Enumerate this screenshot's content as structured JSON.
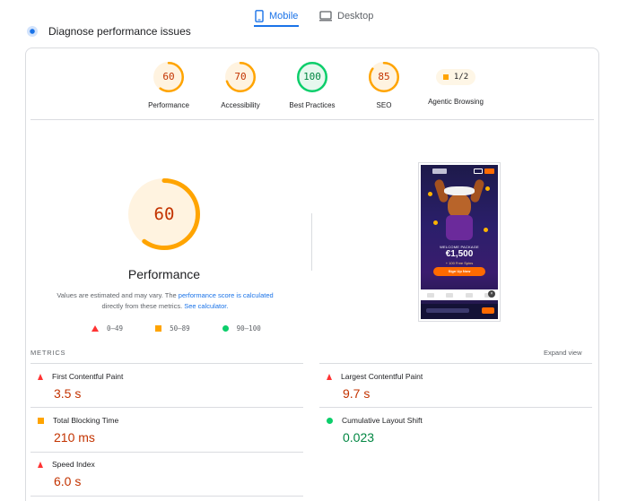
{
  "tabs": [
    {
      "label": "Mobile",
      "active": true
    },
    {
      "label": "Desktop",
      "active": false
    }
  ],
  "section_title": "Diagnose performance issues",
  "categories": [
    {
      "label": "Performance",
      "score": "60",
      "value": 60,
      "color": "#ffa400",
      "bg": "#fff3e0",
      "text_color": "#c33300"
    },
    {
      "label": "Accessibility",
      "score": "70",
      "value": 70,
      "color": "#ffa400",
      "bg": "#fff3e0",
      "text_color": "#c33300"
    },
    {
      "label": "Best Practices",
      "score": "100",
      "value": 100,
      "color": "#0cce6b",
      "bg": "#e6f8ee",
      "text_color": "#018642"
    },
    {
      "label": "SEO",
      "score": "85",
      "value": 85,
      "color": "#ffa400",
      "bg": "#fff3e0",
      "text_color": "#c33300"
    }
  ],
  "agentic": {
    "label": "Agentic Browsing",
    "badge": "1/2"
  },
  "main_gauge": {
    "score": "60",
    "value": 60,
    "label": "Performance",
    "color": "#ffa400"
  },
  "note": {
    "text1": "Values are estimated and may vary. The ",
    "link1": "performance score is calculated",
    "text2": " directly from these metrics. ",
    "link2": "See calculator."
  },
  "legend": {
    "fail": "0–49",
    "average": "50–89",
    "pass": "90–100"
  },
  "screenshot": {
    "package_label": "WELCOME PACKAGE",
    "amount": "€1,500",
    "spins": "+ 100 Free Spins",
    "cta": "Sign Up Now"
  },
  "metrics": {
    "title": "METRICS",
    "expand": "Expand view",
    "items": [
      {
        "name": "First Contentful Paint",
        "value": "3.5 s",
        "status": "fail"
      },
      {
        "name": "Largest Contentful Paint",
        "value": "9.7 s",
        "status": "fail"
      },
      {
        "name": "Total Blocking Time",
        "value": "210 ms",
        "status": "average"
      },
      {
        "name": "Cumulative Layout Shift",
        "value": "0.023",
        "status": "pass"
      },
      {
        "name": "Speed Index",
        "value": "6.0 s",
        "status": "fail"
      }
    ]
  }
}
